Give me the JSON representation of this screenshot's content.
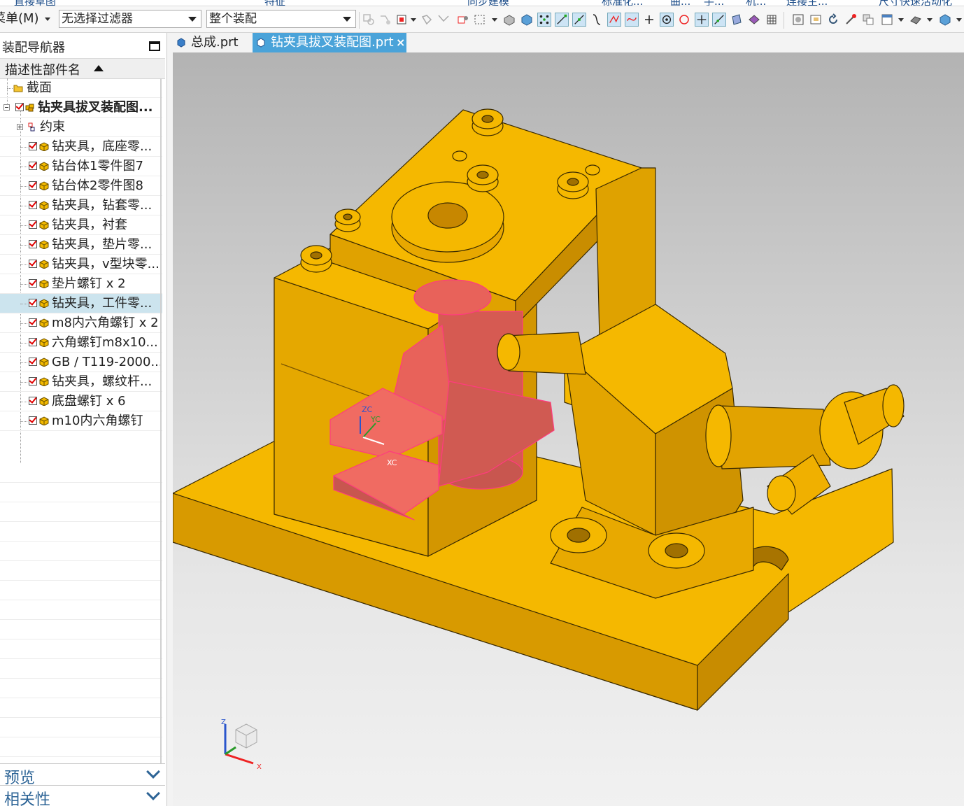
{
  "ribbon": {
    "labels": [
      "直接草图",
      "特征",
      "同步建模",
      "标准化...",
      "曲...",
      "手...",
      "机...",
      "连接主...",
      "尺寸快速活动化"
    ]
  },
  "toolbar": {
    "menu_label": "菜单(M)",
    "filter_combo_value": "无选择过滤器",
    "scope_combo_value": "整个装配"
  },
  "navigator": {
    "title": "装配导航器",
    "column_header": "描述性部件名",
    "items": [
      {
        "label": "截面",
        "type": "folder"
      },
      {
        "label": "钻夹具拔叉装配图...",
        "type": "root"
      },
      {
        "label": "约束",
        "type": "constraints"
      },
      {
        "label": "钻夹具，底座零...",
        "type": "part"
      },
      {
        "label": "钻台体1零件图7",
        "type": "part"
      },
      {
        "label": "钻台体2零件图8",
        "type": "part"
      },
      {
        "label": "钻夹具，钻套零...",
        "type": "part"
      },
      {
        "label": "钻夹具，衬套",
        "type": "part"
      },
      {
        "label": "钻夹具，垫片零...",
        "type": "part"
      },
      {
        "label": "钻夹具，v型块零...",
        "type": "part"
      },
      {
        "label": "垫片螺钉 x 2",
        "type": "part"
      },
      {
        "label": "钻夹具，工件零...",
        "type": "part",
        "selected": true
      },
      {
        "label": "m8内六角螺钉 x 2",
        "type": "part"
      },
      {
        "label": "六角螺钉m8x10...",
        "type": "part"
      },
      {
        "label": "GB / T119-2000...",
        "type": "part"
      },
      {
        "label": "钻夹具，螺纹杆...",
        "type": "part"
      },
      {
        "label": "底盘螺钉 x 6",
        "type": "part"
      },
      {
        "label": "m10内六角螺钉",
        "type": "part"
      }
    ],
    "panels": {
      "preview": "预览",
      "dependencies": "相关性"
    }
  },
  "tabs": [
    {
      "label": "总成.prt",
      "active": false
    },
    {
      "label": "钻夹具拔叉装配图.prt",
      "active": true,
      "close": "×"
    }
  ],
  "viewport": {
    "csys_labels": {
      "zc": "ZC",
      "yc": "YC",
      "xc": "XC"
    },
    "triad_labels": {
      "z": "Z",
      "x": "X"
    },
    "colors": {
      "part_fill": "#f5b800",
      "part_edge": "#3a2a00",
      "highlight_fill": "#e8625a",
      "highlight_edge": "#ff3b7f",
      "background_top": "#b3b3b3",
      "background_bottom": "#f1f1f1"
    }
  }
}
